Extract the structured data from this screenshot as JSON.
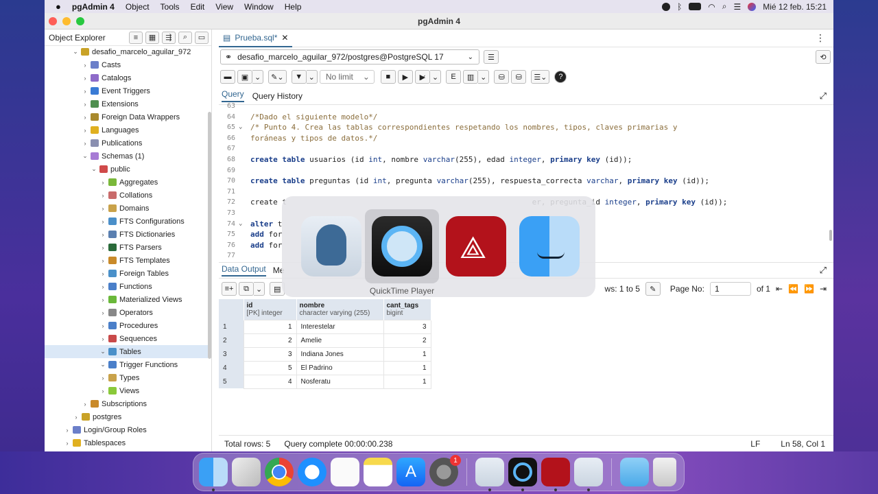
{
  "menubar": {
    "app_name": "pgAdmin 4",
    "items": [
      "Object",
      "Tools",
      "Edit",
      "View",
      "Window",
      "Help"
    ],
    "datetime": "Mié 12 feb.  15:21"
  },
  "window": {
    "title": "pgAdmin 4"
  },
  "sidebar": {
    "title": "Object Explorer",
    "items": [
      {
        "label": "desafio_marcelo_aguilar_972",
        "color": "#c9a227"
      },
      {
        "label": "Casts",
        "color": "#6b7fc9"
      },
      {
        "label": "Catalogs",
        "color": "#8e6bc9"
      },
      {
        "label": "Event Triggers",
        "color": "#3a7bd5"
      },
      {
        "label": "Extensions",
        "color": "#4f8f4f"
      },
      {
        "label": "Foreign Data Wrappers",
        "color": "#a8892c"
      },
      {
        "label": "Languages",
        "color": "#e0b020"
      },
      {
        "label": "Publications",
        "color": "#8a8fb0"
      },
      {
        "label": "Schemas (1)",
        "color": "#a77bd5"
      },
      {
        "label": "public",
        "color": "#d04a4a"
      },
      {
        "label": "Aggregates",
        "color": "#7ab83a"
      },
      {
        "label": "Collations",
        "color": "#c96b6b"
      },
      {
        "label": "Domains",
        "color": "#c9a24a"
      },
      {
        "label": "FTS Configurations",
        "color": "#4a8fc9"
      },
      {
        "label": "FTS Dictionaries",
        "color": "#5a7fb0"
      },
      {
        "label": "FTS Parsers",
        "color": "#2a6a3a"
      },
      {
        "label": "FTS Templates",
        "color": "#c98a2a"
      },
      {
        "label": "Foreign Tables",
        "color": "#4a90c9"
      },
      {
        "label": "Functions",
        "color": "#4a7fc9"
      },
      {
        "label": "Materialized Views",
        "color": "#6ab83a"
      },
      {
        "label": "Operators",
        "color": "#888888"
      },
      {
        "label": "Procedures",
        "color": "#4a7fc9"
      },
      {
        "label": "Sequences",
        "color": "#c94a4a"
      },
      {
        "label": "Tables",
        "color": "#4a90c9"
      },
      {
        "label": "Trigger Functions",
        "color": "#4a7fc9"
      },
      {
        "label": "Types",
        "color": "#c9a24a"
      },
      {
        "label": "Views",
        "color": "#8ac93a"
      },
      {
        "label": "Subscriptions",
        "color": "#c98a2a"
      },
      {
        "label": "postgres",
        "color": "#c9a227"
      },
      {
        "label": "Login/Group Roles",
        "color": "#6b7fc9"
      },
      {
        "label": "Tablespaces",
        "color": "#e0b020"
      }
    ]
  },
  "editor_tab": {
    "label": "Prueba.sql*"
  },
  "connection": {
    "label": "desafio_marcelo_aguilar_972/postgres@PostgreSQL 17"
  },
  "toolbar": {
    "limit": "No limit"
  },
  "query_tabs": [
    "Query",
    "Query History"
  ],
  "code_lines": [
    {
      "n": "63",
      "text": ""
    },
    {
      "n": "64",
      "text": "/*Dado el siguiente modelo*/"
    },
    {
      "n": "65",
      "text": "/* Punto 4. Crea las tablas correspondientes respetando los nombres, tipos, claves primarias y"
    },
    {
      "n": "66",
      "text": "foráneas y tipos de datos.*/"
    },
    {
      "n": "67",
      "text": ""
    },
    {
      "n": "68",
      "text": "create table usuarios (id int, nombre varchar(255), edad integer, primary key (id));"
    },
    {
      "n": "69",
      "text": ""
    },
    {
      "n": "70",
      "text": "create table preguntas (id int, pregunta varchar(255), respuesta_correcta varchar, primary key (id));"
    },
    {
      "n": "71",
      "text": ""
    },
    {
      "n": "72",
      "text": "create t                                                      er, pregunta_id integer, primary key (id));"
    },
    {
      "n": "73",
      "text": ""
    },
    {
      "n": "74",
      "text": "alter t"
    },
    {
      "n": "75",
      "text": "add for"
    },
    {
      "n": "76",
      "text": "add for"
    },
    {
      "n": "77",
      "text": ""
    }
  ],
  "output_tabs": [
    "Data Output",
    "Me"
  ],
  "pager": {
    "rows": "ws: 1 to 5",
    "page_label": "Page No:",
    "page": "1",
    "of": "of 1"
  },
  "grid": {
    "columns": [
      {
        "name": "id",
        "type": "[PK] integer"
      },
      {
        "name": "nombre",
        "type": "character varying (255)"
      },
      {
        "name": "cant_tags",
        "type": "bigint"
      }
    ],
    "rows": [
      {
        "n": "1",
        "id": "1",
        "nombre": "Interestelar",
        "cant": "3"
      },
      {
        "n": "2",
        "id": "2",
        "nombre": "Amelie",
        "cant": "2"
      },
      {
        "n": "3",
        "id": "3",
        "nombre": "Indiana Jones",
        "cant": "1"
      },
      {
        "n": "4",
        "id": "5",
        "nombre": "El Padrino",
        "cant": "1"
      },
      {
        "n": "5",
        "id": "4",
        "nombre": "Nosferatu",
        "cant": "1"
      }
    ]
  },
  "status": {
    "total": "Total rows: 5",
    "query": "Query complete 00:00:00.238",
    "eol": "LF",
    "pos": "Ln 58, Col 1"
  },
  "switcher": {
    "selected_label": "QuickTime Player",
    "apps": [
      "pgadmin-icon",
      "quicktime-icon",
      "acrobat-icon",
      "finder-icon"
    ]
  },
  "dock": {
    "badge": "1"
  }
}
